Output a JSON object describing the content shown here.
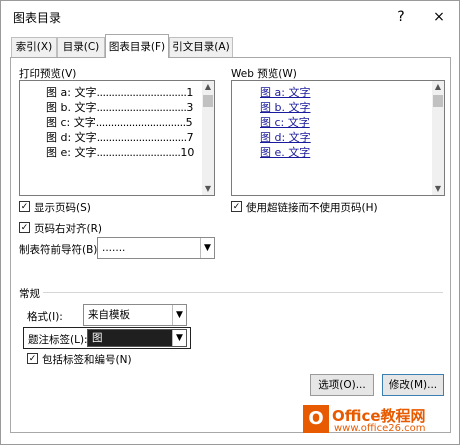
{
  "window": {
    "title": "图表目录",
    "help_label": "?",
    "close_label": "×"
  },
  "tabs": [
    {
      "label": "索引(X)"
    },
    {
      "label": "目录(C)"
    },
    {
      "label": "图表目录(F)"
    },
    {
      "label": "引文目录(A)"
    }
  ],
  "print_preview": {
    "label": "打印预览(V)",
    "entries": [
      {
        "text": "图 a: 文字",
        "dots": "..............................",
        "page": "1"
      },
      {
        "text": "图 b. 文字",
        "dots": "..............................",
        "page": "3"
      },
      {
        "text": "图 c: 文字",
        "dots": "..............................",
        "page": "5"
      },
      {
        "text": "图 d: 文字",
        "dots": "..............................",
        "page": "7"
      },
      {
        "text": "图 e: 文字",
        "dots": "............................",
        "page": "10"
      }
    ]
  },
  "web_preview": {
    "label": "Web 预览(W)",
    "entries": [
      "图 a: 文字",
      "图 b. 文字",
      "图 c: 文字",
      "图 d: 文字",
      "图 e. 文字"
    ]
  },
  "options": {
    "show_page_numbers": {
      "label": "显示页码(S)",
      "checked": true
    },
    "right_align": {
      "label": "页码右对齐(R)",
      "checked": true
    },
    "use_hyperlinks": {
      "label": "使用超链接而不使用页码(H)",
      "checked": true
    },
    "tab_leader": {
      "label": "制表符前导符(B):",
      "value": "......."
    }
  },
  "general": {
    "heading": "常规",
    "formats": {
      "label": "格式(I):",
      "value": "来自模板"
    },
    "caption_label": {
      "label": "题注标签(L):",
      "value": "图"
    },
    "include_label": {
      "label": "包括标签和编号(N)",
      "checked": true
    }
  },
  "buttons": {
    "options": "选项(O)...",
    "modify": "修改(M)..."
  },
  "watermark": {
    "logo_char": "O",
    "text": "Office教程网",
    "url": "www.office26.com"
  },
  "colors": {
    "accent": "#3c7fb1",
    "link": "#1a1a9c",
    "watermark": "#e85a00"
  }
}
